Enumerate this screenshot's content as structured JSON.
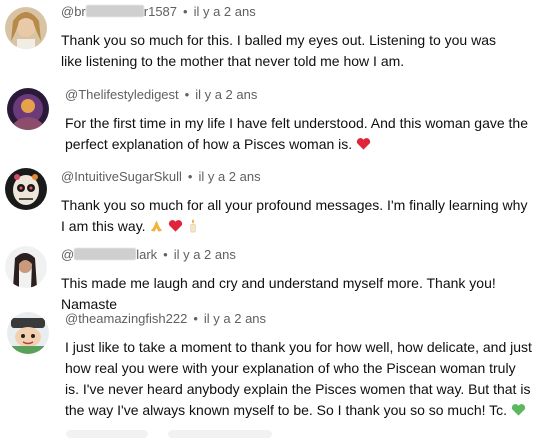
{
  "comments": [
    {
      "author_prefix": "@br",
      "author_suffix": "r1587",
      "time": "il y a 2 ans",
      "text": "Thank you so much for this. I balled my eyes out. Listening to you was like listening to the mother that never told me how I am.",
      "emoji": []
    },
    {
      "author": "@Thelifestyledigest",
      "time": "il y a 2 ans",
      "text": "For the first time in my life I have felt understood. And this woman gave the perfect explanation of how a Pisces woman is.",
      "emoji": [
        "heart-emoji"
      ]
    },
    {
      "author": "@IntuitiveSugarSkull",
      "time": "il y a 2 ans",
      "text": "Thank you so much for all your profound messages. I'm finally learning why I am this way.",
      "emoji": [
        "folded-hands-emoji",
        "heart-emoji",
        "candle-emoji"
      ]
    },
    {
      "author_prefix": "@",
      "author_suffix": "lark",
      "time": "il y a 2 ans",
      "text": "This made me laugh and cry and understand myself more. Thank you! Namaste",
      "emoji": []
    },
    {
      "author": "@theamazingfish222",
      "time": "il y a 2 ans",
      "text": "I just like to take a moment to thank you for how well,  how delicate, and just how real you were with your explanation of who the Piscean woman truly is. I've never heard anybody explain the Pisces women that way. But that is the way I've always known myself to be. So I thank you so so much! Tc.",
      "emoji": [
        "green-heart-emoji"
      ]
    }
  ],
  "separator": "•",
  "colors": {
    "meta_text": "#606060",
    "body_text": "#0f0f0f",
    "heart": "#e0243a",
    "green_heart": "#5cb85c"
  }
}
